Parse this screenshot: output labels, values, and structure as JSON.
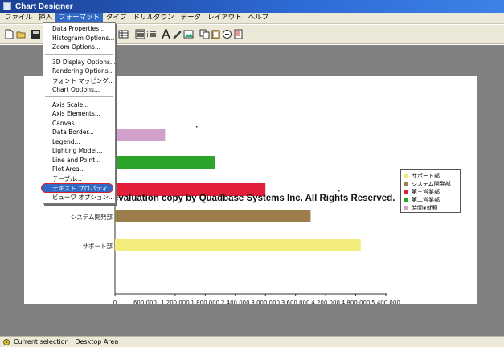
{
  "window": {
    "title": "Chart Designer"
  },
  "menu": {
    "items": [
      "ファイル",
      "挿入",
      "フォーマット",
      "タイプ",
      "ドリルダウン",
      "データ",
      "レイアウト",
      "ヘルプ"
    ],
    "active_index": 2
  },
  "toolbar": {
    "icons": [
      "new-icon",
      "open-icon",
      "save-icon",
      "table-icon",
      "list-icon",
      "list-alt-icon",
      "text-a-icon",
      "pen-icon",
      "image-icon",
      "copy-icon",
      "paste-icon",
      "duplicate-icon",
      "export-icon"
    ]
  },
  "dropdown": {
    "groups": [
      [
        "Data Properties...",
        "Histogram Options...",
        "Zoom Options..."
      ],
      [
        "3D Display Options...",
        "Rendering Options...",
        "フォント マッピング...",
        "Chart Options..."
      ],
      [
        "Axis Scale...",
        "Axis Elements...",
        "Canvas...",
        "Data Border...",
        "Legend...",
        "Lighting Model...",
        "Line and Point...",
        "Plot Area...",
        "テーブル...",
        "テキスト プロパティ...",
        "ビューワ オプション..."
      ]
    ],
    "highlighted": "テキスト プロパティ..."
  },
  "chart_data": {
    "type": "bar",
    "orientation": "horizontal",
    "categories": [
      "サポート部",
      "システム開発部",
      "第三営業部",
      "第二営業部",
      "時間¥就種"
    ],
    "category_labels_visible": [
      "サポート部",
      "システム開発部"
    ],
    "values": [
      4900000,
      3900000,
      3000000,
      2000000,
      1000000
    ],
    "colors": [
      "#f2ec7c",
      "#9c7d4c",
      "#e21e3a",
      "#2aa52a",
      "#d39fcb"
    ],
    "xlim": [
      0,
      5400000
    ],
    "xticks": [
      "0",
      "600,000",
      "1,200,000",
      "1,800,000",
      "2,400,000",
      "3,000,000",
      "3,600,000",
      "4,200,000",
      "4,800,000",
      "5,400,000"
    ],
    "legend": {
      "position": "right",
      "entries": [
        "サポート部",
        "システム開発部",
        "第三営業部",
        "第二営業部",
        "時間¥就種"
      ]
    },
    "watermark": "EspressChart evaluation copy by Quadbase Systems Inc. All Rights Reserved."
  },
  "status": {
    "text": "Current selection : Desktop Area"
  }
}
